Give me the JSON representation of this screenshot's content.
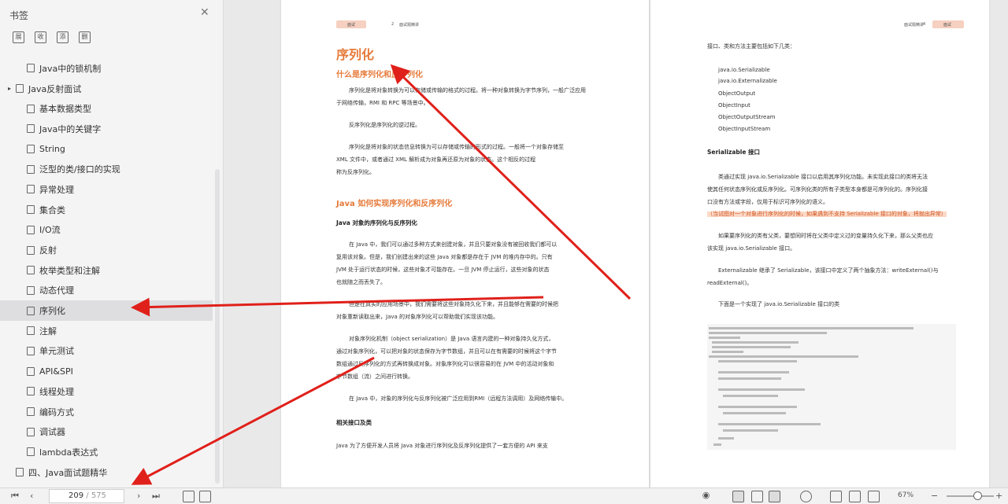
{
  "sidebar": {
    "title": "书签",
    "close_glyph": "✕",
    "tools": [
      "展",
      "收",
      "添",
      "删"
    ],
    "items": [
      {
        "label": "Java中的锁机制",
        "level": 1
      },
      {
        "label": "Java反射面试",
        "level": 0,
        "toggle": "▸"
      },
      {
        "label": "基本数据类型",
        "level": 1
      },
      {
        "label": "Java中的关键字",
        "level": 1
      },
      {
        "label": "String",
        "level": 1
      },
      {
        "label": "泛型的类/接口的实现",
        "level": 1
      },
      {
        "label": "异常处理",
        "level": 1
      },
      {
        "label": "集合类",
        "level": 1
      },
      {
        "label": "I/O流",
        "level": 1
      },
      {
        "label": "反射",
        "level": 1
      },
      {
        "label": "枚举类型和注解",
        "level": 1
      },
      {
        "label": "动态代理",
        "level": 1
      },
      {
        "label": "序列化",
        "level": 1,
        "active": true
      },
      {
        "label": "注解",
        "level": 1
      },
      {
        "label": "单元测试",
        "level": 1
      },
      {
        "label": "API&SPI",
        "level": 1
      },
      {
        "label": "线程处理",
        "level": 1
      },
      {
        "label": "编码方式",
        "level": 1
      },
      {
        "label": "调试器",
        "level": 1
      },
      {
        "label": "lambda表达式",
        "level": 1
      },
      {
        "label": "四、Java面试题精华",
        "level": 0
      }
    ]
  },
  "page_left": {
    "header_tag": "面试",
    "header_num": "2",
    "header_text": "面试题精讲",
    "title": "序列化",
    "section1": "什么是序列化和反序列化",
    "p1": [
      "序列化是将对象转换为可以存储或传输的格式的过程。将一种对象转换为字节序列，一般广泛应用",
      "于网络传输，RMI 和 RPC 等场景中。"
    ],
    "p2": "反序列化是序列化的逆过程。",
    "p3": [
      "序列化是将对象的状态信息转换为可以存储或传输的形式的过程。一般将一个对象存储至",
      "XML 文件中，或者通过 XML 解析成为对象再还原为对象的状态。这个相反的过程",
      "称为反序列化。"
    ],
    "section2": "Java 如何实现序列化和反序列化",
    "section2b": "Java 对象的序列化与反序列化",
    "p4": [
      "在 Java 中，我们可以通过多种方式来创建对象，并且只要对象没有被回收我们都可以",
      "复用该对象。但是，我们创建出来的这些 Java 对象都是存在于 JVM 的堆内存中的。只有",
      "JVM 处于运行状态的时候，这些对象才可能存在。一旦 JVM 停止运行，这些对象的状态",
      "也就随之而丢失了。"
    ],
    "p5": [
      "但是在真实的应用场景中，我们需要将这些对象持久化下来，并且能够在需要的时候把",
      "对象重新读取出来，Java 的对象序列化可以帮助我们实现该功能。"
    ],
    "p6": [
      "对象序列化机制（object serialization）是 Java 语言内建的一种对象持久化方式，",
      "通过对象序列化，可以把对象的状态保存为字节数组，并且可以在有需要的时候将这个字节",
      "数组通过反序列化的方式再转换成对象。对象序列化可以很容易的在 JVM 中的活动对象和",
      "字节数组（流）之间进行转换。"
    ],
    "p7": "在 Java 中，对象的序列化与反序列化被广泛应用到RMI（远程方法调用）及网络传输中。",
    "section3": "相关接口及类",
    "p8": "Java 为了方便开发人员将 Java 对象进行序列化及反序列化提供了一套方便的 API 来支"
  },
  "page_right": {
    "header_text": "面试题精讲",
    "header_num": "4",
    "header_tag": "面试",
    "intro": "接口、类和方法主要包括如下几类：",
    "list": [
      "java.io.Serializable",
      "java.io.Externalizable",
      "ObjectOutput",
      "ObjectInput",
      "ObjectOutputStream",
      "ObjectInputStream"
    ],
    "section": "Serializable 接口",
    "p1": [
      "类通过实现 java.io.Serializable 接口以启用其序列化功能。未实现此接口的类将无法",
      "使其任何状态序列化或反序列化。可序列化类的所有子类型本身都是可序列化的。序列化接",
      "口没有方法或字段，仅用于标识可序列化的语义。"
    ],
    "p1_note": "（当试图对一个对象进行序列化的时候，如果遇到不支持 Serializable 接口的对象，将抛出异常）",
    "p2": [
      "如果要序列化的类有父类，要想同时将在父类中定义过的变量持久化下来，那么父类也应",
      "该实现 java.io.Serializable 接口。"
    ],
    "p3": [
      "Externalizable 继承了 Serializable，该接口中定义了两个抽象方法：writeExternal()与",
      "readExternal()。"
    ],
    "p4": "下面是一个实现了 java.io.Serializable 接口的类"
  },
  "bottom": {
    "first": "⏮",
    "prev": "‹",
    "page_current": "209",
    "page_total": "/ 575",
    "next": "›",
    "last": "⏭",
    "zoom": "67%",
    "zoom_out": "−",
    "zoom_in": "+"
  },
  "colors": {
    "accent": "#e67a3a",
    "arrow": "#e0201a",
    "highlight": "#fbd9c6"
  }
}
